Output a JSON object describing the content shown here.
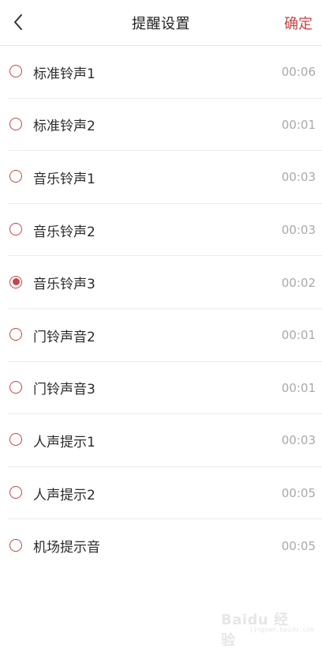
{
  "header": {
    "title": "提醒设置",
    "confirm_label": "确定"
  },
  "colors": {
    "accent": "#c44646",
    "text": "#2b2b2b",
    "secondary_text": "#a9a9a9"
  },
  "ringtones": [
    {
      "label": "标准铃声1",
      "duration": "00:06",
      "selected": false
    },
    {
      "label": "标准铃声2",
      "duration": "00:01",
      "selected": false
    },
    {
      "label": "音乐铃声1",
      "duration": "00:03",
      "selected": false
    },
    {
      "label": "音乐铃声2",
      "duration": "00:03",
      "selected": false
    },
    {
      "label": "音乐铃声3",
      "duration": "00:02",
      "selected": true
    },
    {
      "label": "门铃声音2",
      "duration": "00:01",
      "selected": false
    },
    {
      "label": "门铃声音3",
      "duration": "00:01",
      "selected": false
    },
    {
      "label": "人声提示1",
      "duration": "00:03",
      "selected": false
    },
    {
      "label": "人声提示2",
      "duration": "00:05",
      "selected": false
    },
    {
      "label": "机场提示音",
      "duration": "00:05",
      "selected": false
    }
  ],
  "watermark": {
    "brand": "Baidu 经验",
    "url": "jingyan.baidu.com"
  }
}
